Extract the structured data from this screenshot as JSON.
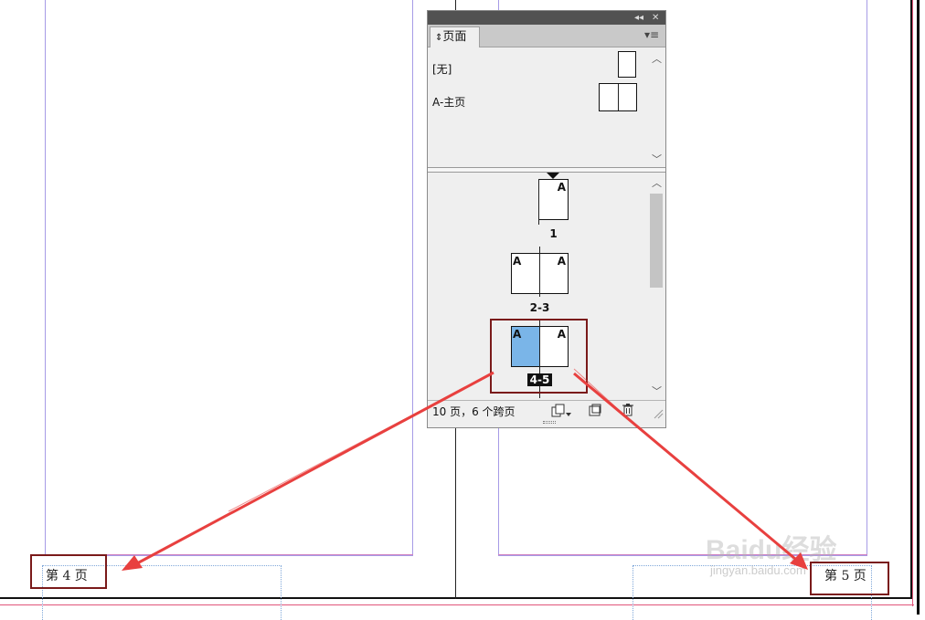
{
  "document": {
    "folio_left": "第 4 页",
    "folio_right": "第 5 页"
  },
  "pages_panel": {
    "collapse_glyph": "◂◂",
    "close_glyph": "✕",
    "tab_label": "页面",
    "tab_arrows": "⇕",
    "menu_glyph": "▾≡",
    "masters": [
      {
        "label": "[无]"
      },
      {
        "label": "A-主页"
      }
    ],
    "spreads": [
      {
        "label": "1",
        "left_letter": "",
        "right_letter": "A"
      },
      {
        "label": "2-3",
        "left_letter": "A",
        "right_letter": "A"
      },
      {
        "label": "4-5",
        "left_letter": "A",
        "right_letter": "A",
        "selected": true
      }
    ],
    "status": "10 页，6 个跨页",
    "scroll_up": "︿",
    "scroll_down": "﹀"
  },
  "watermark": {
    "brand": "Baidu经验",
    "url": "jingyan.baidu.com"
  },
  "colors": {
    "selection": "#7ab5e8",
    "annotation_red": "#e8403f",
    "highlight_box": "#7a1a1a"
  }
}
